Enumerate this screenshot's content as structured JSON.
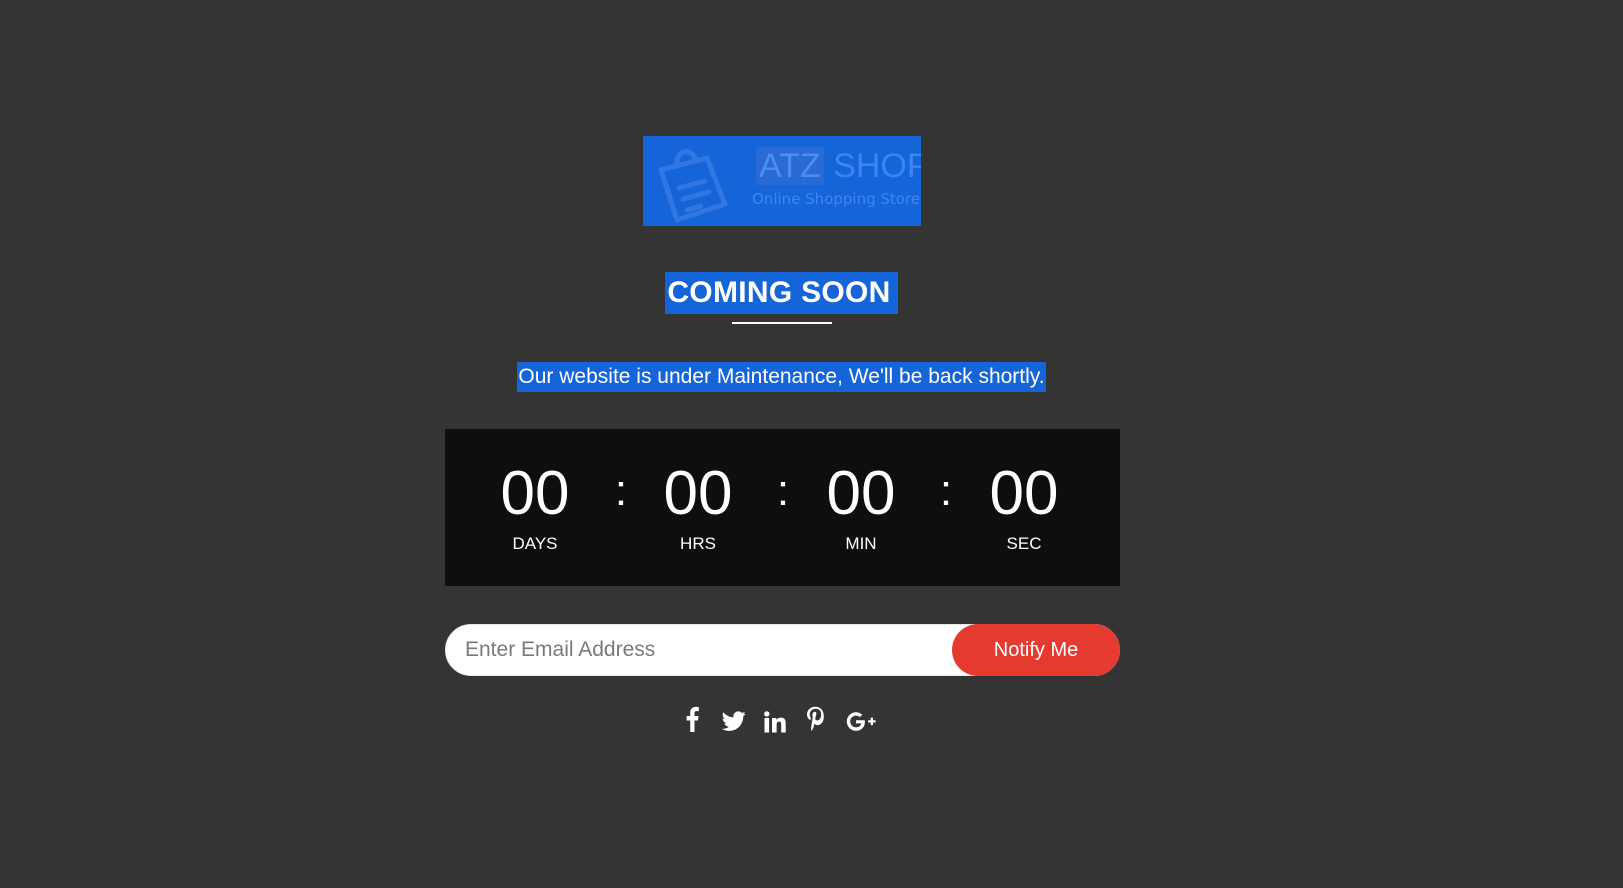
{
  "brand": {
    "name_part1": "ATZ",
    "name_part2": "SHOP",
    "tagline": "Online Shopping Store"
  },
  "heading": "COMING SOON",
  "subtitle": "Our website is under Maintenance, We'll be back shortly.",
  "countdown": {
    "units": [
      {
        "value": "00",
        "label": "DAYS"
      },
      {
        "value": "00",
        "label": "HRS"
      },
      {
        "value": "00",
        "label": "MIN"
      },
      {
        "value": "00",
        "label": "SEC"
      }
    ],
    "separator": ":"
  },
  "notify": {
    "placeholder": "Enter Email Address",
    "button_label": "Notify Me"
  },
  "social_icons": [
    "facebook-icon",
    "twitter-icon",
    "linkedin-icon",
    "pinterest-icon",
    "google-plus-icon"
  ],
  "colors": {
    "background": "#343434",
    "highlight": "#1565d8",
    "countdown_bg": "#0e0e0e",
    "button": "#e53a2f"
  }
}
